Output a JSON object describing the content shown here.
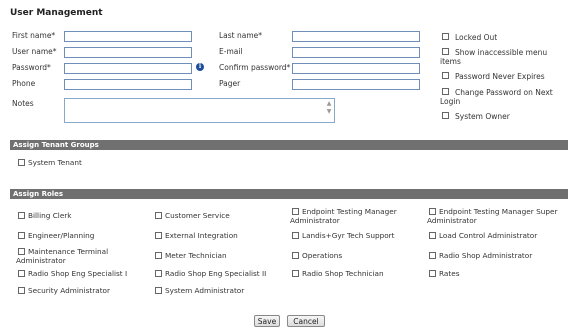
{
  "title": "User Management",
  "fields": {
    "first_name": {
      "label": "First name*",
      "value": ""
    },
    "last_name": {
      "label": "Last name*",
      "value": ""
    },
    "user_name": {
      "label": "User name*",
      "value": ""
    },
    "email": {
      "label": "E-mail",
      "value": ""
    },
    "password": {
      "label": "Password*",
      "value": ""
    },
    "confirm_password": {
      "label": "Confirm password*",
      "value": ""
    },
    "phone": {
      "label": "Phone",
      "value": ""
    },
    "pager": {
      "label": "Pager",
      "value": ""
    },
    "notes": {
      "label": "Notes",
      "value": ""
    }
  },
  "options": {
    "locked_out": "Locked Out",
    "show_inaccessible_a": "Show inaccessible menu",
    "show_inaccessible_b": "items",
    "password_never_expires": "Password Never Expires",
    "change_password_a": "Change Password on Next",
    "change_password_b": "Login",
    "system_owner": "System Owner"
  },
  "tenant_groups": {
    "header": "Assign Tenant Groups",
    "items": [
      "System Tenant"
    ]
  },
  "roles": {
    "header": "Assign Roles",
    "items": [
      "Billing Clerk",
      "Customer Service",
      "Endpoint Testing Manager Administrator",
      "Endpoint Testing Manager Super Administrator",
      "Engineer/Planning",
      "External Integration",
      "Landis+Gyr Tech Support",
      "Load Control Administrator",
      "Maintenance Terminal Administrator",
      "Meter Technician",
      "Operations",
      "Radio Shop Administrator",
      "Radio Shop Eng Specialist I",
      "Radio Shop Eng Specialist II",
      "Radio Shop Technician",
      "Rates",
      "Security Administrator",
      "System Administrator"
    ]
  },
  "buttons": {
    "save": "Save",
    "cancel": "Cancel"
  }
}
